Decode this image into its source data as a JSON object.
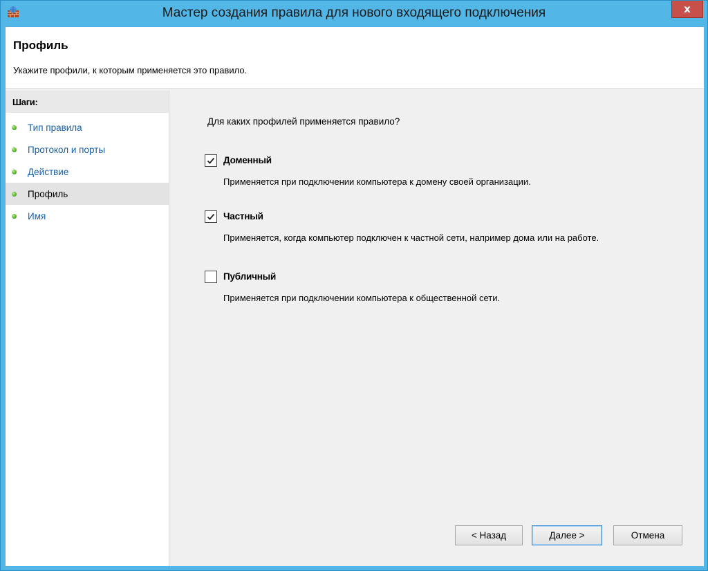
{
  "window": {
    "title": "Мастер создания правила для нового входящего подключения",
    "close_label": "x"
  },
  "header": {
    "title": "Профиль",
    "subtitle": "Укажите профили, к которым применяется это правило."
  },
  "steps": {
    "title": "Шаги:",
    "items": [
      {
        "label": "Тип правила"
      },
      {
        "label": "Протокол и порты"
      },
      {
        "label": "Действие"
      },
      {
        "label": "Профиль"
      },
      {
        "label": "Имя"
      }
    ]
  },
  "main": {
    "question": "Для каких профилей применяется правило?",
    "options": [
      {
        "label": "Доменный",
        "checked": true,
        "description": "Применяется при подключении компьютера к домену своей организации."
      },
      {
        "label": "Частный",
        "checked": true,
        "description": "Применяется, когда компьютер подключен к частной сети, например дома или на работе."
      },
      {
        "label": "Публичный",
        "checked": false,
        "description": "Применяется при подключении компьютера к общественной сети."
      }
    ]
  },
  "buttons": {
    "back": "< Назад",
    "next": "Далее >",
    "cancel": "Отмена"
  }
}
